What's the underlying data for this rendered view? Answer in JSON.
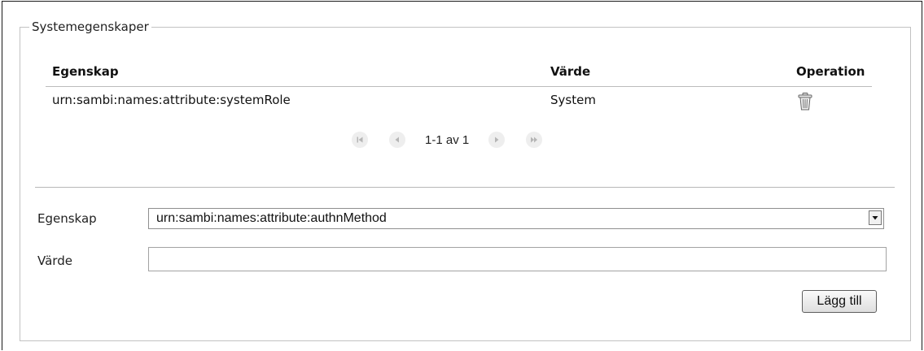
{
  "section_title": "Systemegenskaper",
  "table": {
    "headers": {
      "property": "Egenskap",
      "value": "Värde",
      "operation": "Operation"
    },
    "rows": [
      {
        "property": "urn:sambi:names:attribute:systemRole",
        "value": "System",
        "operation_icon": "trash-icon"
      }
    ]
  },
  "pagination": {
    "first_icon": "first-page-icon",
    "prev_icon": "previous-page-icon",
    "range_text": "1-1 av 1",
    "next_icon": "next-page-icon",
    "last_icon": "last-page-icon"
  },
  "form": {
    "property_label": "Egenskap",
    "property_selected": "urn:sambi:names:attribute:authnMethod",
    "value_label": "Värde",
    "value_input": "",
    "add_button_label": "Lägg till"
  }
}
